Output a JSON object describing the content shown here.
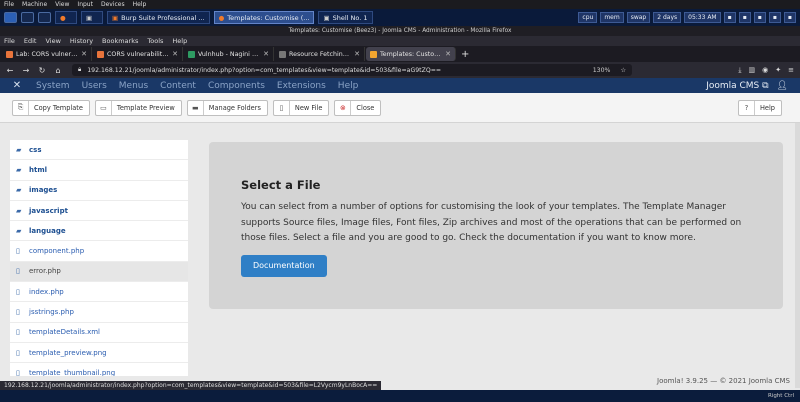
{
  "vm_menu": [
    "File",
    "Machine",
    "View",
    "Input",
    "Devices",
    "Help"
  ],
  "taskbar": {
    "tasks": [
      {
        "label": "",
        "icon": "firefox-icon"
      },
      {
        "label": "",
        "icon": "terminal-icon"
      },
      {
        "label": "Burp Suite Professional ...",
        "icon": "burp-icon"
      },
      {
        "label": "Templates: Customise (...",
        "icon": "firefox-icon",
        "active": true
      },
      {
        "label": "Shell No. 1",
        "icon": "terminal-icon"
      }
    ],
    "chips": [
      "cpu",
      "mem",
      "swap",
      "2 days",
      "05:33 AM"
    ]
  },
  "browser": {
    "window_title": "Templates: Customise (Beez3) - Joomla CMS - Administration - Mozilla Firefox",
    "menu": [
      "File",
      "Edit",
      "View",
      "History",
      "Bookmarks",
      "Tools",
      "Help"
    ],
    "tabs": [
      {
        "label": "Lab: CORS vulnerability w...",
        "fav_color": "#e8743b",
        "active": false
      },
      {
        "label": "CORS vulnerability with ...",
        "fav_color": "#e8743b",
        "active": false
      },
      {
        "label": "Vulnhub - Nagini Walkth...",
        "fav_color": "#2e9b62",
        "active": false
      },
      {
        "label": "Resource Fetching Page",
        "fav_color": "#777777",
        "active": false
      },
      {
        "label": "Templates: Customise (B...",
        "fav_color": "#f2a52f",
        "active": true
      }
    ],
    "url": "192.168.12.21/joomla/administrator/index.php?option=com_templates&view=template&id=503&file=aG9tZQ==",
    "zoom": "130%",
    "status_url": "192.168.12.21/joomla/administrator/index.php?option=com_templates&view=template&id=503&file=L2Vycm9yLnBocA=="
  },
  "joomla": {
    "menu": [
      "System",
      "Users",
      "Menus",
      "Content",
      "Components",
      "Extensions",
      "Help"
    ],
    "site_name": "Joomla CMS ⧉",
    "user_icon": "↑",
    "toolbar": {
      "copy": "Copy Template",
      "preview": "Template Preview",
      "folders": "Manage Folders",
      "newfile": "New File",
      "close": "Close",
      "help": "Help"
    },
    "tree": [
      {
        "label": "css",
        "type": "folder"
      },
      {
        "label": "html",
        "type": "folder"
      },
      {
        "label": "images",
        "type": "folder"
      },
      {
        "label": "javascript",
        "type": "folder"
      },
      {
        "label": "language",
        "type": "folder"
      },
      {
        "label": "component.php",
        "type": "file"
      },
      {
        "label": "error.php",
        "type": "file",
        "selected": true
      },
      {
        "label": "index.php",
        "type": "file"
      },
      {
        "label": "jsstrings.php",
        "type": "file"
      },
      {
        "label": "templateDetails.xml",
        "type": "file"
      },
      {
        "label": "template_preview.png",
        "type": "file"
      },
      {
        "label": "template_thumbnail.png",
        "type": "file"
      }
    ],
    "card": {
      "title": "Select a File",
      "description": "You can select from a number of options for customising the look of your templates. The Template Manager supports Source files, Image files, Font files, Zip archives and most of the operations that can be performed on those files. Select a file and you are good to go. Check the documentation if you want to know more.",
      "button": "Documentation"
    },
    "footer": "Joomla! 3.9.25 — © 2021 Joomla CMS"
  },
  "tray_text": "Right Ctrl",
  "colors": {
    "joomla_header": "#1a3867",
    "accent": "#2f7fc6"
  }
}
